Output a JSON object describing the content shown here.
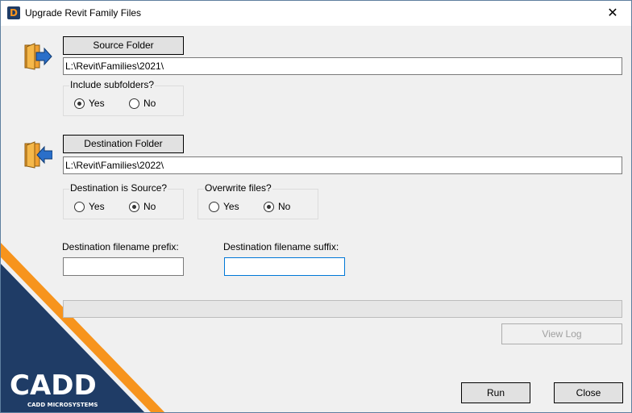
{
  "window": {
    "title": "Upgrade Revit Family Files",
    "app_icon_letter": "D",
    "close_glyph": "✕"
  },
  "source": {
    "button_label": "Source Folder",
    "path": "L:\\Revit\\Families\\2021\\",
    "include_subfolders": {
      "label": "Include subfolders?",
      "options": [
        {
          "label": "Yes",
          "selected": true
        },
        {
          "label": "No",
          "selected": false
        }
      ]
    }
  },
  "destination": {
    "button_label": "Destination Folder",
    "path": "L:\\Revit\\Families\\2022\\",
    "is_source": {
      "label": "Destination is Source?",
      "options": [
        {
          "label": "Yes",
          "selected": false
        },
        {
          "label": "No",
          "selected": true
        }
      ]
    },
    "overwrite": {
      "label": "Overwrite files?",
      "options": [
        {
          "label": "Yes",
          "selected": false
        },
        {
          "label": "No",
          "selected": true
        }
      ]
    },
    "prefix": {
      "label": "Destination filename prefix:",
      "value": ""
    },
    "suffix": {
      "label": "Destination filename suffix:",
      "value": ""
    }
  },
  "progress": {
    "value_percent": 0
  },
  "actions": {
    "view_log_label": "View Log",
    "run_label": "Run",
    "close_label": "Close"
  },
  "logo": {
    "wordmark": "CADD",
    "tagline": "CADD MICROSYSTEMS"
  },
  "colors": {
    "brand_navy": "#1f3c66",
    "brand_orange": "#f7941d",
    "folder_orange": "#f0a030",
    "arrow_blue": "#2a6fc9"
  },
  "icons": {
    "source": "folder-in-icon",
    "destination": "folder-out-icon"
  }
}
